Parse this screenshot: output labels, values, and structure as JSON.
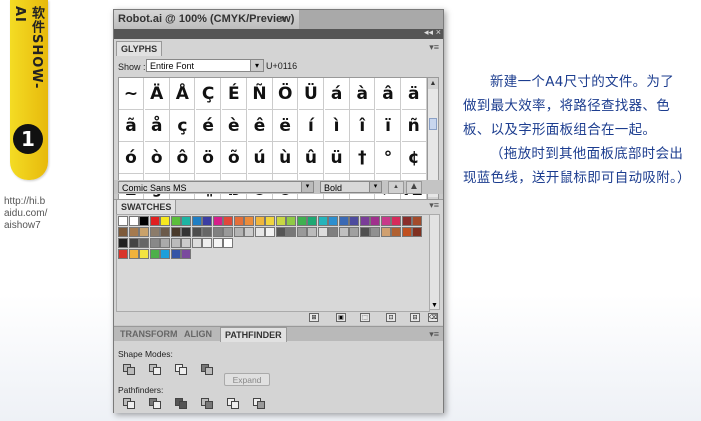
{
  "sidebar": {
    "banner_text": "软件SHOW-AI",
    "step_number": "1",
    "url_lines": [
      "http://hi.b",
      "aidu.com/",
      "aishow7"
    ],
    "accent_color": "#f0cf1c"
  },
  "window": {
    "doc_title": "Robot.ai @ 100% (CMYK/Preview)",
    "close_glyph": "×",
    "collapse_glyph": "◂◂",
    "strip_close_glyph": "×"
  },
  "glyphs_panel": {
    "tab_label": "GLYPHS",
    "menu_glyph": "▾≡",
    "show_label": "Show :",
    "show_value": "Entire Font",
    "dropdown_arrow": "▾",
    "unicode_value": "U+0116",
    "scroll_up": "▲",
    "scroll_down": "▼",
    "glyphs": [
      [
        "~",
        "Ä",
        "Å",
        "Ç",
        "É",
        "Ñ",
        "Ö",
        "Ü",
        "á",
        "à",
        "â",
        "ä"
      ],
      [
        "ã",
        "å",
        "ç",
        "é",
        "è",
        "ê",
        "ë",
        "í",
        "ì",
        "î",
        "ï",
        "ñ"
      ],
      [
        "ó",
        "ò",
        "ô",
        "ö",
        "õ",
        "ú",
        "ù",
        "û",
        "ü",
        "†",
        "°",
        "¢"
      ],
      [
        "£",
        "§",
        "•",
        "¶",
        "ß",
        "®",
        "©",
        "™",
        "´",
        "¨",
        "≠",
        "Æ"
      ]
    ],
    "font_family": "Comic Sans MS",
    "font_style": "Bold",
    "zoom_out_icon": "▲",
    "zoom_in_icon": "▲"
  },
  "swatches_panel": {
    "tab_label": "SWATCHES",
    "menu_glyph": "▾≡",
    "row1_colors": [
      "#ffffff",
      "#ffffff",
      "#000000",
      "#e02020",
      "#f6e81e",
      "#5cbf3b",
      "#1db4a3",
      "#1f7ec4",
      "#3b3da3",
      "#d61f8a",
      "#e0483a",
      "#e46f3a",
      "#eb8c3b",
      "#f0b63d",
      "#f1d53f",
      "#c9d743",
      "#8fca45",
      "#3fb050",
      "#1ea873",
      "#25b4bb",
      "#2c8fcf",
      "#3a69b4",
      "#4d4b9e",
      "#7a3d98",
      "#a0308d",
      "#c93a8a",
      "#d62b5b",
      "#8a2d2a",
      "#a34b2b"
    ],
    "row2_colors": [
      "#7d5a3a",
      "#a57a4e",
      "#c9a26b",
      "#8c7c6a",
      "#6b5a4a",
      "#4a3a2a",
      "#333333",
      "#4d4d4d",
      "#666666",
      "#808080",
      "#999999",
      "#b3b3b3",
      "#cccccc",
      "#e6e6e6",
      "#f2f2f2",
      "#555555",
      "#777777",
      "#999999",
      "#bbbbbb",
      "#dddddd",
      "#7f7f7f",
      "#c0c0c0",
      "#a0a0a0",
      "#505050",
      "#909090",
      "#d0a070",
      "#b06030",
      "#c05020",
      "#803020"
    ],
    "row3_colors": [
      "#222222",
      "#444444",
      "#666666",
      "#888888",
      "#aaaaaa",
      "#bbbbbb",
      "#cccccc",
      "#dddddd",
      "#eeeeee",
      "#f5f5f5",
      "#ffffff"
    ],
    "row4_colors": [
      "#d9342b",
      "#f0b23b",
      "#f4e342",
      "#4daf4a",
      "#1c9fdb",
      "#3454a6",
      "#7a4a9e"
    ],
    "scroll_down": "▼",
    "footer_icons": [
      "⊞",
      "▣",
      "⬚",
      "⊡",
      "⊟",
      "⌫"
    ]
  },
  "pathfinder_panel": {
    "tabs": [
      "TRANSFORM",
      "ALIGN",
      "PATHFINDER"
    ],
    "menu_glyph": "▾≡",
    "shape_modes_label": "Shape Modes:",
    "expand_label": "Expand",
    "pathfinders_label": "Pathfinders:"
  },
  "description": {
    "paragraphs": [
      "新建一个A4尺寸的文件。为了做到最大效率，将路径查找器、色板、以及字形面板组合在一起。",
      "（拖放时到其他面板底部时会出现蓝色线，送开鼠标即可自动吸附。）"
    ],
    "text_color": "#1c3d8f"
  }
}
